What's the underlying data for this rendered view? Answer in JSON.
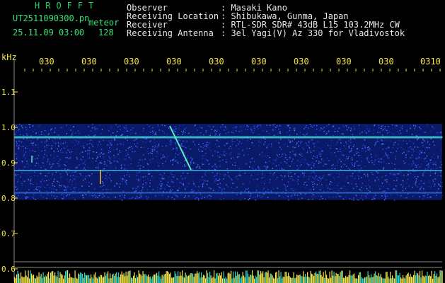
{
  "header": {
    "brand": "HROFFT",
    "filename": "UT2511090300.pn",
    "event_label": "meteor",
    "timestamp": "25.11.09 03:00",
    "count": "128"
  },
  "info": [
    {
      "label": "Observer",
      "value": ": Masaki Kano"
    },
    {
      "label": "Receiving Location",
      "value": ": Shibukawa, Gunma, Japan"
    },
    {
      "label": "Receiver",
      "value": ": RTL-SDR SDR# 43dB L15 103.2MHz CW"
    },
    {
      "label": "Receiving Antenna",
      "value": ": 3el Yagi(V) Az 330 for Vladivostok"
    }
  ],
  "chart_data": {
    "type": "heatmap",
    "ylabel": "kHz",
    "y_ticks": [
      "1.1",
      "1.0",
      "0.9",
      "0.8",
      "0.7",
      "0.6"
    ],
    "x_ticks": [
      "030",
      "030",
      "030",
      "030",
      "030",
      "030",
      "030",
      "030",
      "030",
      "030",
      "0310"
    ],
    "ylim": [
      0.6,
      1.1
    ],
    "grid": true,
    "colors": {
      "background": "#000000",
      "noise": "#1a3fc8",
      "signal": "#4fe0d0",
      "text": "#f2e44b",
      "axis": "#8a8a8a",
      "bars": "#f2e44b"
    }
  }
}
